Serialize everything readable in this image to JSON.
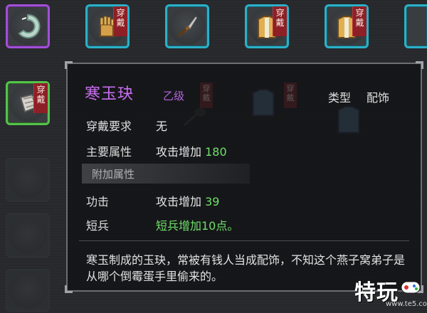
{
  "inventory": {
    "top_row": [
      {
        "name": "jade-ring",
        "quality": "purple",
        "wear": false
      },
      {
        "name": "gauntlet",
        "quality": "cyan",
        "wear": true
      },
      {
        "name": "dagger",
        "quality": "cyan",
        "wear": false
      },
      {
        "name": "robe",
        "quality": "cyan",
        "wear": true
      },
      {
        "name": "robe",
        "quality": "cyan",
        "wear": true
      },
      {
        "name": "partial",
        "quality": "cyan",
        "wear": false
      }
    ],
    "left_column": [
      {
        "name": "bracer",
        "quality": "green",
        "wear": true
      },
      {
        "name": "empty",
        "quality": "empty",
        "wear": false
      },
      {
        "name": "empty",
        "quality": "empty",
        "wear": false
      },
      {
        "name": "empty",
        "quality": "empty",
        "wear": false
      }
    ],
    "wear_tag_line1": "穿",
    "wear_tag_line2": "戴"
  },
  "tooltip": {
    "name": "寒玉玦",
    "grade": "乙级",
    "type_label": "类型",
    "type_value": "配饰",
    "requirement_label": "穿戴要求",
    "requirement_value": "无",
    "main_attr_label": "主要属性",
    "main_attr_value": "攻击增加",
    "main_attr_number": "180",
    "extra_section_title": "附加属性",
    "extra_1_label": "功击",
    "extra_1_value": "攻击增加",
    "extra_1_number": "39",
    "extra_2_label": "短兵",
    "extra_2_value": "短兵增加10点。",
    "description": "寒玉制成的玉玦，常被有钱人当成配饰，不知这个燕子窝弟子是从哪个倒霉蛋手里偷来的。"
  },
  "watermark": {
    "text": "特玩",
    "url": "www.te5.com"
  },
  "colors": {
    "purple_quality": "#a24fd6",
    "cyan_quality": "#2ab0c8",
    "green_quality": "#55c24a",
    "item_name": "#c86ef0",
    "bonus_green": "#6fe06a",
    "wear_tag": "#8e1f26"
  }
}
